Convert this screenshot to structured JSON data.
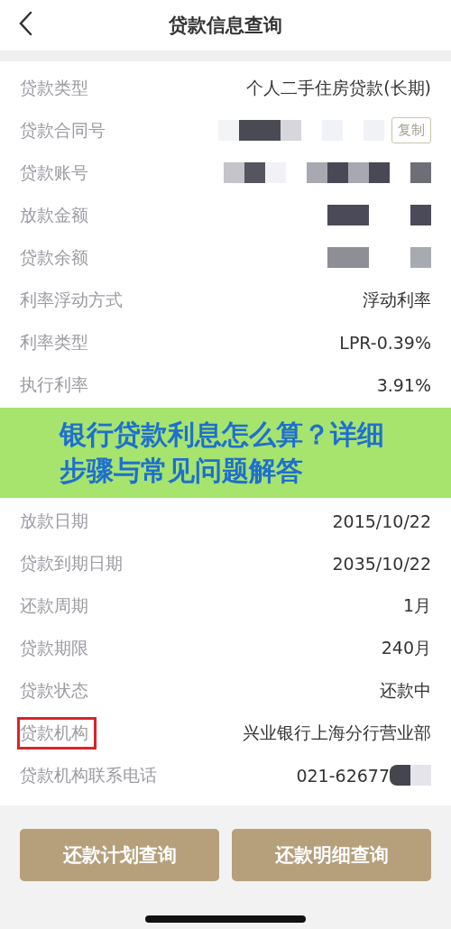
{
  "header": {
    "title": "贷款信息查询"
  },
  "rows": [
    {
      "kind": "plain",
      "label": "贷款类型",
      "value": "个人二手住房贷款(长期)",
      "highlighted": false
    },
    {
      "kind": "masked_copy",
      "label": "贷款合同号",
      "copy_button": "复制",
      "highlighted": false
    },
    {
      "kind": "masked",
      "label": "贷款账号",
      "highlighted": false
    },
    {
      "kind": "masked",
      "label": "放款金额",
      "highlighted": false
    },
    {
      "kind": "masked",
      "label": "贷款余额",
      "highlighted": false
    },
    {
      "kind": "plain",
      "label": "利率浮动方式",
      "value": "浮动利率",
      "highlighted": false
    },
    {
      "kind": "plain",
      "label": "利率类型",
      "value": "LPR-0.39%",
      "highlighted": false
    },
    {
      "kind": "plain",
      "label": "执行利率",
      "value": "3.91%",
      "highlighted": false
    },
    {
      "kind": "banner",
      "text": "银行贷款利息怎么算？详细步骤与常见问题解答"
    },
    {
      "kind": "plain",
      "label": "放款日期",
      "value": "2015/10/22",
      "highlighted": false
    },
    {
      "kind": "plain",
      "label": "贷款到期日期",
      "value": "2035/10/22",
      "highlighted": false
    },
    {
      "kind": "plain",
      "label": "还款周期",
      "value": "1月",
      "highlighted": false
    },
    {
      "kind": "plain",
      "label": "贷款期限",
      "value": "240月",
      "highlighted": false
    },
    {
      "kind": "plain",
      "label": "贷款状态",
      "value": "还款中",
      "highlighted": false
    },
    {
      "kind": "plain",
      "label": "贷款机构",
      "value": "兴业银行上海分行营业部",
      "highlighted": true
    },
    {
      "kind": "partly_masked",
      "label": "贷款机构联系电话",
      "value": "021-62677",
      "highlighted": false
    }
  ],
  "buttons": [
    "还款计划查询",
    "还款明细查询"
  ]
}
